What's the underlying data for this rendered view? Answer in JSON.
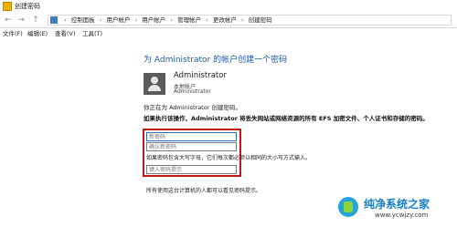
{
  "window": {
    "title": "创建密码"
  },
  "address_bar": {
    "nav": [
      "←",
      "→",
      "↑"
    ],
    "segments": [
      "控制面板",
      "用户帐户",
      "用户帐户",
      "管理帐户",
      "更改帐户",
      "创建密码"
    ],
    "separator": "›"
  },
  "menu": {
    "items": [
      "文件(F)",
      "编辑(E)",
      "查看(V)",
      "工具(T)"
    ]
  },
  "content": {
    "heading": "为 Administrator 的帐户创建一个密码",
    "user": {
      "name": "Administrator",
      "type": "本地帐户",
      "group": "Administrator"
    },
    "info": "你正在为 Administrator 创建密码。",
    "warning": "如果执行该操作，Administrator 将丢失网站或网络资源的所有 EFS 加密文件、个人证书和存储的密码。",
    "fields": {
      "new_password_placeholder": "新密码",
      "confirm_password_placeholder": "确认新密码",
      "hint_placeholder": "键入密码提示"
    },
    "caps_hint": "如果密码包含大写字母，它们每次都必须以相同的大小写方式输入。",
    "hint_note": "所有使用这台计算机的人都可以看见密码提示。"
  },
  "watermark": {
    "title": "纯净系统之家",
    "url": "www.ycwjzy.com"
  },
  "colors": {
    "heading": "#1f5ba8",
    "highlight": "#c21818",
    "field_active": "#2a6ebd"
  }
}
